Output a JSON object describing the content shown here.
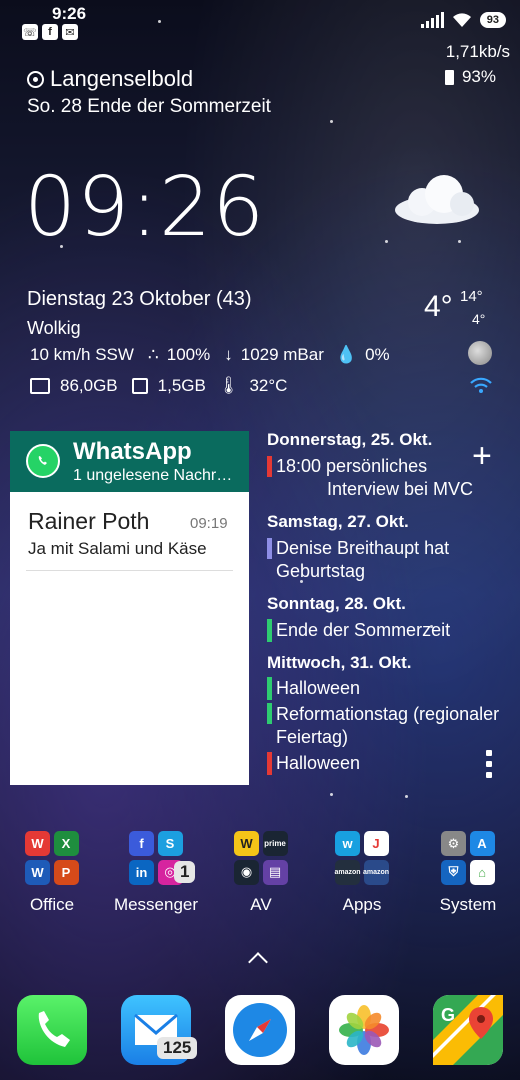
{
  "status_bar": {
    "time": "9:26",
    "battery_percent": "93",
    "net_speed": "1,71kb/s",
    "battery_text": "93%"
  },
  "location": "Langenselbold",
  "event_line": "So. 28 Ende der Sommerzeit",
  "clock": "09:26",
  "date_line": "Dienstag 23 Oktober (43)",
  "weather": {
    "condition": "Wolkig",
    "wind": "10 km/h SSW",
    "humidity": "100%",
    "pressure": "1029 mBar",
    "precip": "0%",
    "temp_now": "4°",
    "temp_high": "14°",
    "temp_low": "4°"
  },
  "system": {
    "storage": "86,0GB",
    "memory": "1,5GB",
    "cpu_temp": "32°C"
  },
  "whatsapp": {
    "title": "WhatsApp",
    "subtitle": "1 ungelesene Nachr…",
    "sender": "Rainer Poth",
    "time": "09:19",
    "message": "Ja mit Salami und Käse"
  },
  "calendar": {
    "days": [
      {
        "label": "Donnerstag, 25. Okt."
      },
      {
        "label": "Samstag, 27. Okt."
      },
      {
        "label": "Sonntag, 28. Okt."
      },
      {
        "label": "Mittwoch, 31. Okt."
      }
    ],
    "events": [
      {
        "line1": "18:00 persönliches",
        "line2": "Interview bei MVC",
        "color": "#e53935"
      },
      {
        "line1": "Denise Breithaupt hat",
        "line2": "Geburtstag",
        "color": "#8e8ee6"
      },
      {
        "line1": "Ende der Sommerzeit",
        "color": "#2ecc71"
      },
      {
        "line1": "Halloween",
        "color": "#2ecc71"
      },
      {
        "line1": "Reformationstag (regionaler",
        "line2": "Feiertag)",
        "color": "#2ecc71"
      },
      {
        "line1": "Halloween",
        "color": "#e53935"
      }
    ],
    "add_symbol": "+"
  },
  "folders": [
    {
      "label": "Office",
      "icon": "office-folder-icon"
    },
    {
      "label": "Messenger",
      "icon": "messenger-folder-icon",
      "badge": "1"
    },
    {
      "label": "AV",
      "icon": "av-folder-icon"
    },
    {
      "label": "Apps",
      "icon": "apps-folder-icon"
    },
    {
      "label": "System",
      "icon": "system-folder-icon"
    }
  ],
  "dock": {
    "mail_badge": "125"
  }
}
